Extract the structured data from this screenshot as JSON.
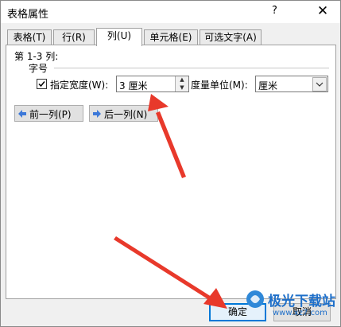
{
  "window": {
    "title": "表格属性",
    "help_label": "?",
    "close_label": "✕"
  },
  "tabs": [
    {
      "label": "表格(T)"
    },
    {
      "label": "行(R)"
    },
    {
      "label": "列(U)",
      "active": true
    },
    {
      "label": "单元格(E)"
    },
    {
      "label": "可选文字(A)"
    }
  ],
  "column": {
    "range_label": "第 1-3 列:",
    "size_label": "字号",
    "width_checkbox_label": "指定宽度(W):",
    "width_checked": true,
    "width_value": "3 厘米",
    "unit_label": "度量单位(M):",
    "unit_value": "厘米",
    "prev_button": "前一列(P)",
    "next_button": "后一列(N)"
  },
  "footer": {
    "ok_label": "确定",
    "cancel_label": "取消"
  },
  "watermark": {
    "text": "极光下载站",
    "url_text": "www.xz7.com"
  },
  "colors": {
    "accent": "#0078d7",
    "arrow": "#e8392b",
    "nav_arrow": "#3c78d8"
  }
}
